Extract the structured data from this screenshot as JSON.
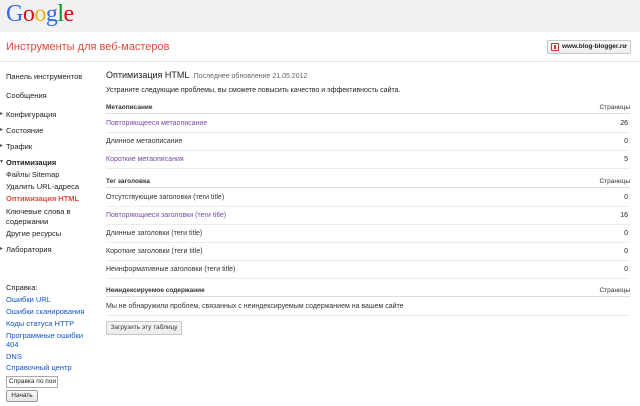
{
  "brand": {
    "logo_letters": [
      "G",
      "o",
      "o",
      "g",
      "l",
      "e"
    ],
    "logo_colors": [
      "#3369e8",
      "#d50f25",
      "#eeb211",
      "#3369e8",
      "#009925",
      "#d50f25"
    ]
  },
  "header": {
    "app_title": "Инструменты для веб-мастеров",
    "site": "www.blog-blogger.ru"
  },
  "sidebar": {
    "items": [
      {
        "label": "Панель инструментов"
      },
      {
        "label": "Сообщения"
      },
      {
        "label": "Конфигурация"
      },
      {
        "label": "Состояние"
      },
      {
        "label": "Трафик"
      },
      {
        "label": "Оптимизация"
      },
      {
        "label": "Файлы Sitemap"
      },
      {
        "label": "Удалить URL-адреса"
      },
      {
        "label": "Оптимизация HTML"
      },
      {
        "label": "Ключевые слова в"
      },
      {
        "label": "содержании"
      },
      {
        "label": "Другие ресурсы"
      },
      {
        "label": "Лаборатория"
      }
    ],
    "help_title": "Справка:",
    "help_links": [
      "Ошибки URL",
      "Ошибки сканирования",
      "Коды статуса HTTP",
      "Программные ошибки",
      "404",
      "DNS",
      "Справочный центр"
    ],
    "help_search_value": "Справка по пои",
    "help_button": "Начать"
  },
  "main": {
    "title": "Оптимизация HTML",
    "updated": "Последнее обновление 21.05.2012",
    "intro": "Устраните следующие проблемы, вы сможете повысить качество и эффективность сайта.",
    "sections": [
      {
        "label": "Метаописание",
        "col": "Страницы",
        "rows": [
          {
            "name": "Повторяющееся метаописание",
            "count": "26"
          },
          {
            "name": "Длинное метаописание",
            "count": "0"
          },
          {
            "name": "Короткие метаописания",
            "count": "5"
          }
        ]
      },
      {
        "label": "Тег заголовка",
        "col": "Страницы",
        "rows": [
          {
            "name": "Отсутствующие заголовки (теги title)",
            "count": "0"
          },
          {
            "name": "Повторяющиеся заголовки (теги title)",
            "count": "16"
          },
          {
            "name": "Длинные заголовки (теги title)",
            "count": "0"
          },
          {
            "name": "Короткие заголовки (теги title)",
            "count": "0"
          },
          {
            "name": "Неинформативные заголовки (теги title)",
            "count": "0"
          }
        ]
      },
      {
        "label": "Неиндексируемое содержание",
        "col": "Страницы",
        "rows": [
          {
            "name": "Мы не обнаружили проблем, связанных с неиндексируемым содержанием на вашем сайте",
            "count": ""
          }
        ]
      }
    ],
    "export_button": "Загрузить эту таблицу"
  },
  "colors": {
    "accent": "#dd4b39",
    "link": "#1155cc",
    "visited_link": "#7b4aa8"
  }
}
